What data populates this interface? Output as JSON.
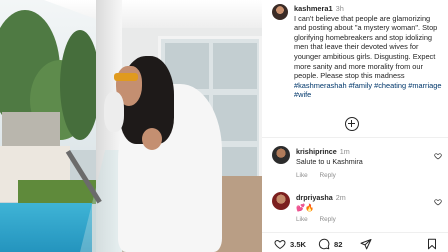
{
  "post": {
    "username": "kashmera1",
    "time": "3h",
    "caption": "I can't believe that people are glamorizing and posting about \"a mystery woman\". Stop glorifying homebreakers and stop idolizing men that leave their devoted wives for younger ambitious girls. Disgusting. Expect more sanity and more morality from our people. Please stop this madness",
    "hashtags": "#kashmerashah #family #cheating #marriage #wife"
  },
  "comments": [
    {
      "username": "krishiprince",
      "time": "1m",
      "text": "Salute to u Kashmira",
      "like_label": "Like",
      "reply_label": "Reply"
    },
    {
      "username": "drpriyasha",
      "time": "2m",
      "text": "💕🔥",
      "like_label": "Like",
      "reply_label": "Reply"
    }
  ],
  "actions": {
    "likes": "3.5K",
    "comments": "82",
    "share_icon": "send-icon",
    "save_icon": "bookmark-icon"
  },
  "colors": {
    "text": "#262626",
    "muted": "#8e8e8e",
    "hashtag": "#00376b"
  }
}
